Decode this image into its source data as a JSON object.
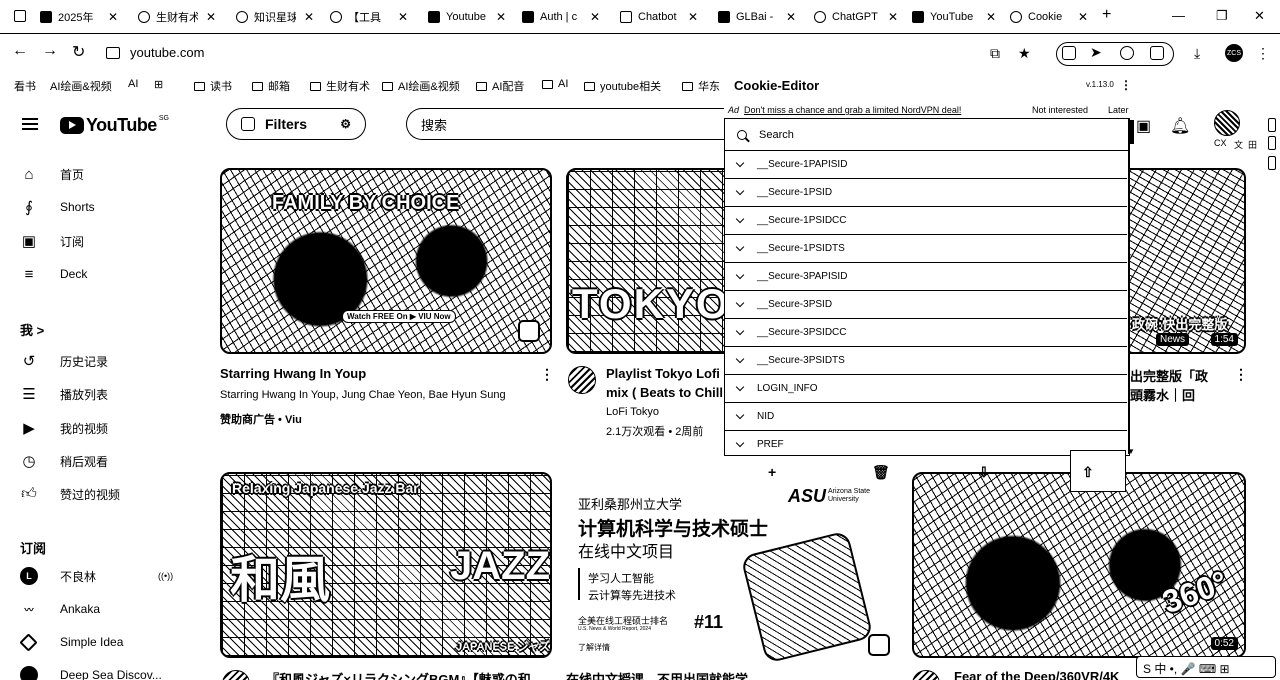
{
  "browser": {
    "tabs": [
      {
        "label": "2025年"
      },
      {
        "label": "生财有术"
      },
      {
        "label": "知识星球"
      },
      {
        "label": "【工具"
      },
      {
        "label": "Youtube"
      },
      {
        "label": "Auth | c"
      },
      {
        "label": "Chatbot"
      },
      {
        "label": "GLBai -"
      },
      {
        "label": "ChatGPT"
      },
      {
        "label": "YouTube"
      },
      {
        "label": "Cookie"
      }
    ],
    "url": "youtube.com",
    "bookmarks": [
      {
        "label": "看书"
      },
      {
        "label": "AI绘画&视频"
      },
      {
        "label": "AI"
      },
      {
        "label": "读书"
      },
      {
        "label": "邮箱"
      },
      {
        "label": "生财有术"
      },
      {
        "label": "AI绘画&视频"
      },
      {
        "label": "AI配音"
      },
      {
        "label": "AI"
      },
      {
        "label": "youtube相关"
      },
      {
        "label": "华东"
      }
    ],
    "profile_initials": "ZCS"
  },
  "youtube": {
    "logo_text": "YouTube",
    "logo_country": "SG",
    "filters_label": "Filters",
    "search_placeholder": "搜索",
    "tiny_icons": [
      "CX",
      "文",
      "田"
    ],
    "sidebar": {
      "main": [
        {
          "label": "首页"
        },
        {
          "label": "Shorts"
        },
        {
          "label": "订阅"
        },
        {
          "label": "Deck"
        }
      ],
      "you_heading": "我 >",
      "you": [
        {
          "label": "历史记录"
        },
        {
          "label": "播放列表"
        },
        {
          "label": "我的视频"
        },
        {
          "label": "稍后观看"
        },
        {
          "label": "赞过的视频"
        }
      ],
      "subs_heading": "订阅",
      "subs": [
        {
          "label": "不良林",
          "live": "((•))"
        },
        {
          "label": "Ankaka"
        },
        {
          "label": "Simple Idea"
        },
        {
          "label": "Deep Sea Discov..."
        }
      ]
    },
    "videos": [
      {
        "title": "Starring Hwang In Youp",
        "line2": "Starring Hwang In Youp, Jung Chae Yeon, Bae Hyun Sung",
        "line3": "赞助商广告 • Viu",
        "thumb_text": "FAMILY BY CHOICE",
        "thumb_sub": "Watch FREE On ▶ VIU Now"
      },
      {
        "title": "Playlist Tokyo Lofi",
        "title2": "mix ( Beats to Chill",
        "channel": "LoFi Tokyo",
        "stats": "2.1万次观看 • 2周前",
        "thumb_text": "TOKYO"
      },
      {
        "title": "出完整版「政",
        "title2": "頭霧水｜回",
        "thumb_text": "政碗:快出完整版",
        "badge": "1:54",
        "news": "News"
      },
      {
        "title": "『和風ジャズ×リラクシングBGM』【魅惑の和",
        "thumb_text_top": "Relaxing Japanese Jazz Bar",
        "thumb_text_left": "和風",
        "thumb_text_right": "JAZZ",
        "thumb_text_bottom": "JAPANESE ジャズ"
      },
      {
        "title": "在线中文授课，不用出国就能学",
        "ad_univ": "亚利桑那州立大学",
        "ad_logo": "ASU",
        "ad_logo_sub": "Arizona State University",
        "ad_heading1": "计算机科学与技术硕士",
        "ad_heading2": "在线中文项目",
        "ad_bullet1": "学习人工智能",
        "ad_bullet2": "云计算等先进技术",
        "ad_rank_text": "全美在线工程硕士排名",
        "ad_rank_source": "U.S. News & World Report, 2024",
        "ad_rank": "#11",
        "ad_more": "了解详情"
      },
      {
        "title": "Fear of the Deep/360VR/4K",
        "badge": "0:52",
        "thumb_text": "360°"
      }
    ]
  },
  "cookie_editor": {
    "title": "Cookie-Editor",
    "version": "v.1.13.0",
    "ad_tag": "Ad",
    "ad_text": "Don't miss a chance and grab a limited NordVPN deal!",
    "not_interested": "Not interested",
    "later": "Later",
    "search_placeholder": "Search",
    "cookies": [
      {
        "name": "__Secure-1PAPISID"
      },
      {
        "name": "__Secure-1PSID"
      },
      {
        "name": "__Secure-1PSIDCC"
      },
      {
        "name": "__Secure-1PSIDTS"
      },
      {
        "name": "__Secure-3PAPISID"
      },
      {
        "name": "__Secure-3PSID"
      },
      {
        "name": "__Secure-3PSIDCC"
      },
      {
        "name": "__Secure-3PSIDTS"
      },
      {
        "name": "LOGIN_INFO"
      },
      {
        "name": "NID"
      },
      {
        "name": "PREF"
      }
    ],
    "toolbar": {
      "add": "+",
      "delete": "🗑",
      "import": "⇩",
      "export": "⇧"
    }
  },
  "ime": {
    "label": "S 中 •, 🎤 ⌨ ⊞"
  }
}
